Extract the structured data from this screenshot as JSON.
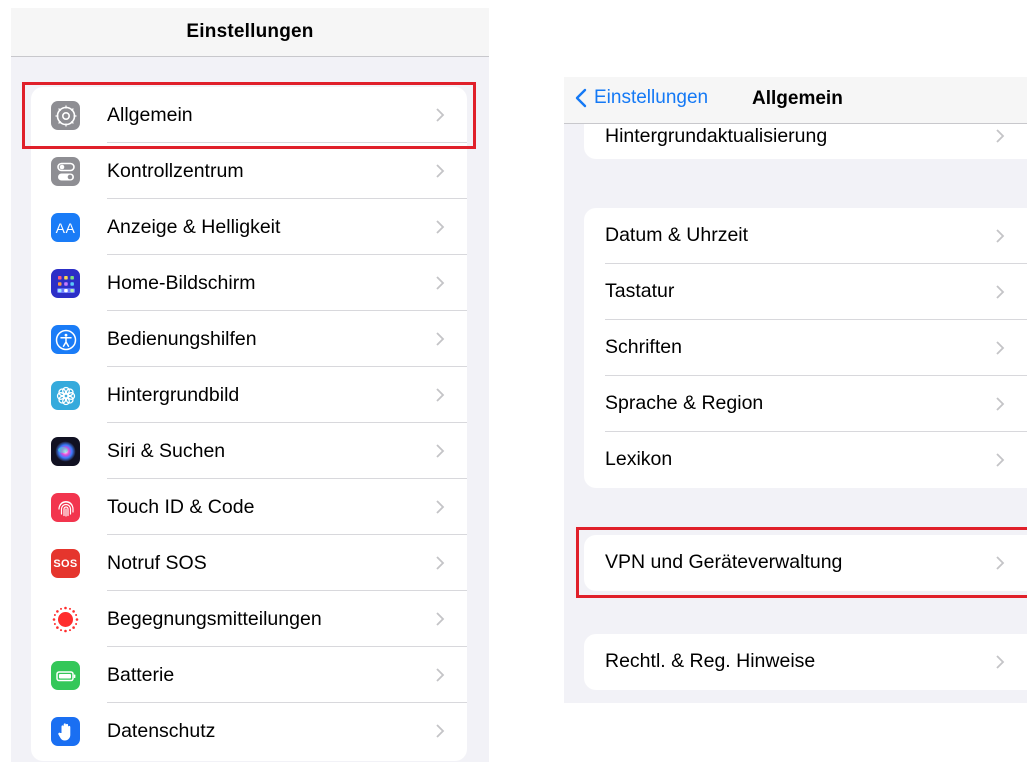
{
  "left": {
    "title": "Einstellungen",
    "items": [
      {
        "label": "Allgemein",
        "icon": "gear-icon",
        "color": "#8e8e93"
      },
      {
        "label": "Kontrollzentrum",
        "icon": "toggles-icon",
        "color": "#8e8e93"
      },
      {
        "label": "Anzeige & Helligkeit",
        "icon": "text-size-icon",
        "icon_text": "AA",
        "color": "#1a7cf7"
      },
      {
        "label": "Home-Bildschirm",
        "icon": "app-grid-icon",
        "color": "#2c2fc7"
      },
      {
        "label": "Bedienungshilfen",
        "icon": "accessibility-icon",
        "color": "#1a7cf7"
      },
      {
        "label": "Hintergrundbild",
        "icon": "flower-icon",
        "color": "#35aadc"
      },
      {
        "label": "Siri & Suchen",
        "icon": "siri-icon",
        "color": "#1c1c2e"
      },
      {
        "label": "Touch ID & Code",
        "icon": "fingerprint-icon",
        "color": "#f2354e"
      },
      {
        "label": "Notruf SOS",
        "icon": "sos-icon",
        "icon_text": "SOS",
        "color": "#e5352d"
      },
      {
        "label": "Begegnungsmitteilungen",
        "icon": "exposure-notification-icon",
        "color": "#ffffff"
      },
      {
        "label": "Batterie",
        "icon": "battery-icon",
        "color": "#34c759"
      },
      {
        "label": "Datenschutz",
        "icon": "hand-icon",
        "color": "#1a6ff2"
      }
    ]
  },
  "right": {
    "back_label": "Einstellungen",
    "title": "Allgemein",
    "groups": [
      {
        "items": [
          {
            "label": "Hintergrundaktualisierung"
          }
        ]
      },
      {
        "items": [
          {
            "label": "Datum & Uhrzeit"
          },
          {
            "label": "Tastatur"
          },
          {
            "label": "Schriften"
          },
          {
            "label": "Sprache & Region"
          },
          {
            "label": "Lexikon"
          }
        ]
      },
      {
        "items": [
          {
            "label": "VPN und Geräteverwaltung"
          }
        ]
      },
      {
        "items": [
          {
            "label": "Rechtl. & Reg. Hinweise"
          }
        ]
      }
    ]
  },
  "colors": {
    "highlight": "#e0202a",
    "link": "#1479f5",
    "background": "#f2f2f7"
  }
}
